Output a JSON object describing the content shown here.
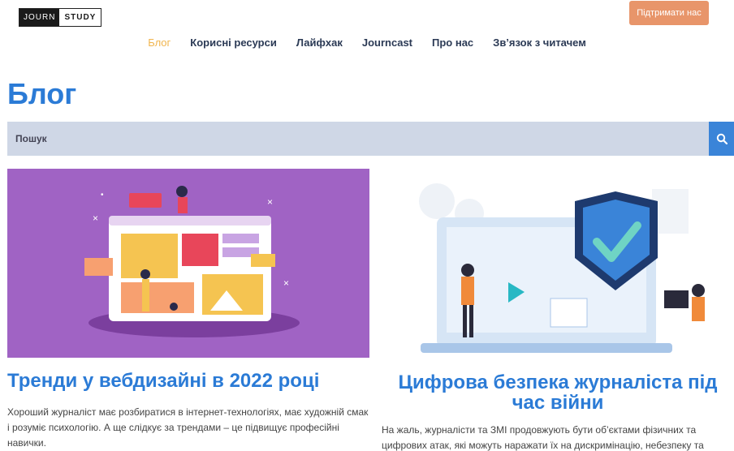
{
  "header": {
    "logo_left": "JOURN",
    "logo_right": "STUDY",
    "support_label": "Підтримати нас"
  },
  "nav": {
    "items": [
      {
        "label": "Блог",
        "active": true
      },
      {
        "label": "Корисні ресурси"
      },
      {
        "label": "Лайфхак"
      },
      {
        "label": "Journcast"
      },
      {
        "label": "Про нас"
      },
      {
        "label": "Зв’язок з читачем"
      }
    ]
  },
  "page": {
    "title": "Блог",
    "search_placeholder": "Пошук"
  },
  "posts": [
    {
      "title": "Тренди у вебдизайні в 2022 році",
      "excerpt": "Хороший журналіст має розбиратися в інтернет-технологіях, має художній смак і розуміє психологію. А ще слідкує за трендами – це підвищує професійні навички."
    },
    {
      "title": "Цифрова безпека журналіста під час війни",
      "excerpt": "На жаль, журналісти та ЗМІ продовжують бути об’єктами фізичних та цифрових атак, які можуть наражати їх на дискримінацію, небезпеку та"
    }
  ],
  "colors": {
    "accent": "#2b7bd6",
    "support_button": "#e8956a",
    "nav_active": "#f1b54e",
    "card1_background": "#a063c4"
  },
  "icons": [
    "search-icon"
  ]
}
